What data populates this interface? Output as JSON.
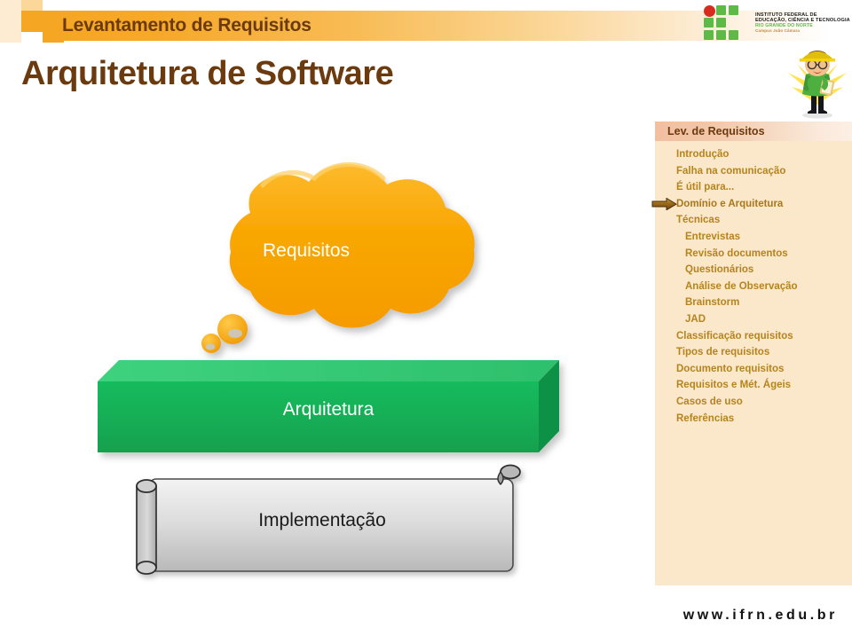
{
  "header": {
    "eyebrow": "Levantamento de Requisitos",
    "title": "Arquitetura de Software",
    "accent_color": "#F5A623",
    "title_color": "#6B3A0E"
  },
  "logo": {
    "line1": "INSTITUTO FEDERAL DE",
    "line2": "EDUCAÇÃO, CIÊNCIA E TECNOLOGIA",
    "line3": "RIO GRANDE DO NORTE",
    "line4": "Campus João Câmara",
    "green": "#5EB947",
    "red": "#D82B20"
  },
  "panel": {
    "heading": "Lev. de Requisitos",
    "background": "#FBE7C9",
    "text_color": "#B5841F",
    "current_index": 3,
    "items": [
      {
        "label": "Introdução",
        "indent": false
      },
      {
        "label": "Falha na comunicação",
        "indent": false
      },
      {
        "label": "É útil para...",
        "indent": false
      },
      {
        "label": "Domínio e Arquitetura",
        "indent": false
      },
      {
        "label": "Técnicas",
        "indent": false
      },
      {
        "label": "Entrevistas",
        "indent": true
      },
      {
        "label": "Revisão documentos",
        "indent": true
      },
      {
        "label": "Questionários",
        "indent": true
      },
      {
        "label": "Análise de Observação",
        "indent": true
      },
      {
        "label": "Brainstorm",
        "indent": true
      },
      {
        "label": "JAD",
        "indent": true
      },
      {
        "label": "Classificação requisitos",
        "indent": false
      },
      {
        "label": "Tipos de requisitos",
        "indent": false
      },
      {
        "label": "Documento requisitos",
        "indent": false
      },
      {
        "label": "Requisitos e Mét. Ágeis",
        "indent": false
      },
      {
        "label": "Casos de uso",
        "indent": false
      },
      {
        "label": "Referências",
        "indent": false
      }
    ]
  },
  "diagram": {
    "cloud": {
      "label": "Requisitos",
      "color": "#F7A600"
    },
    "box": {
      "label": "Arquitetura",
      "color": "#17B35A"
    },
    "scroll": {
      "label": "Implementação",
      "color": "#CFCFCF"
    }
  },
  "footer": {
    "url": "www.ifrn.edu.br"
  }
}
